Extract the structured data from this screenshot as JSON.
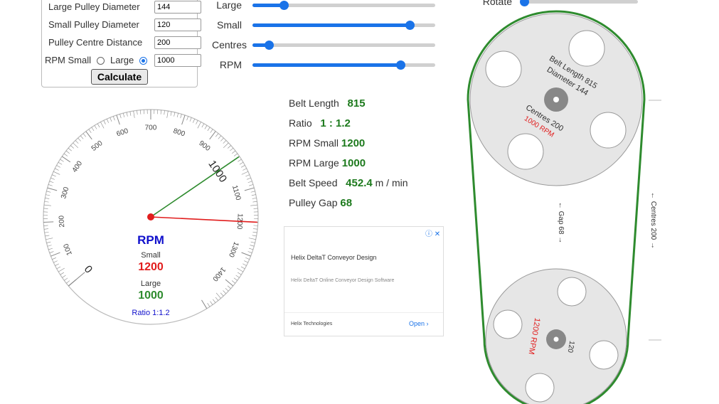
{
  "form": {
    "large_label": "Large Pulley Diameter",
    "large_value": "144",
    "small_label": "Small Pulley Diameter",
    "small_value": "120",
    "centre_label": "Pulley Centre Distance",
    "centre_value": "200",
    "rpm_label_small": "RPM Small",
    "rpm_label_large": "Large",
    "rpm_value": "1000",
    "rpm_selected": "Large",
    "calculate_label": "Calculate"
  },
  "sliders": [
    {
      "label": "Large",
      "level": 0.17
    },
    {
      "label": "Small",
      "level": 0.86
    },
    {
      "label": "Centres",
      "level": 0.09
    },
    {
      "label": "RPM",
      "level": 0.81
    }
  ],
  "rotate": {
    "label": "Rotate",
    "level": 0.0
  },
  "results": {
    "belt_length_label": "Belt Length",
    "belt_length_value": "815",
    "ratio_label": "Ratio",
    "ratio_value": "1 : 1.2",
    "rpm_small_label": "RPM Small",
    "rpm_small_value": "1200",
    "rpm_large_label": "RPM Large",
    "rpm_large_value": "1000",
    "belt_speed_label": "Belt Speed",
    "belt_speed_value": "452.4",
    "belt_speed_unit": "m / min",
    "pulley_gap_label": "Pulley Gap",
    "pulley_gap_value": "68"
  },
  "gauge": {
    "title": "RPM",
    "small_label": "Small",
    "small_value": "1200",
    "large_label": "Large",
    "large_value": "1000",
    "ratio_text": "Ratio 1:1.2",
    "major_ticks": [
      "0",
      "100",
      "200",
      "300",
      "400",
      "500",
      "600",
      "700",
      "800",
      "900",
      "1000",
      "1100",
      "1200",
      "1300",
      "1400"
    ],
    "big_labels": [
      "0",
      "1000"
    ],
    "needle_large_rpm": 1000,
    "needle_small_rpm": 1200,
    "colors": {
      "large": "#2e8b2e",
      "small": "#e11d1d",
      "title": "#1010cc"
    }
  },
  "ad": {
    "title": "Helix DeltaT Conveyor Design",
    "subtitle": "Helix DeltaT Online Conveyor Design Software",
    "advertiser": "Helix Technologies",
    "cta": "Open",
    "icons": "ⓘ ✕"
  },
  "diagram": {
    "large_text_1": "Belt Length 815",
    "large_text_2": "Diameter 144",
    "large_text_3": "Centres 200",
    "large_text_4": "1000 RPM",
    "small_rpm": "1200 RPM",
    "small_diameter": "120",
    "gap_text": "← Gap 68 →",
    "centres_text": "← Centres 200 →",
    "belt_color": "#2e8b2e",
    "rpm_color": "#e11d1d"
  }
}
